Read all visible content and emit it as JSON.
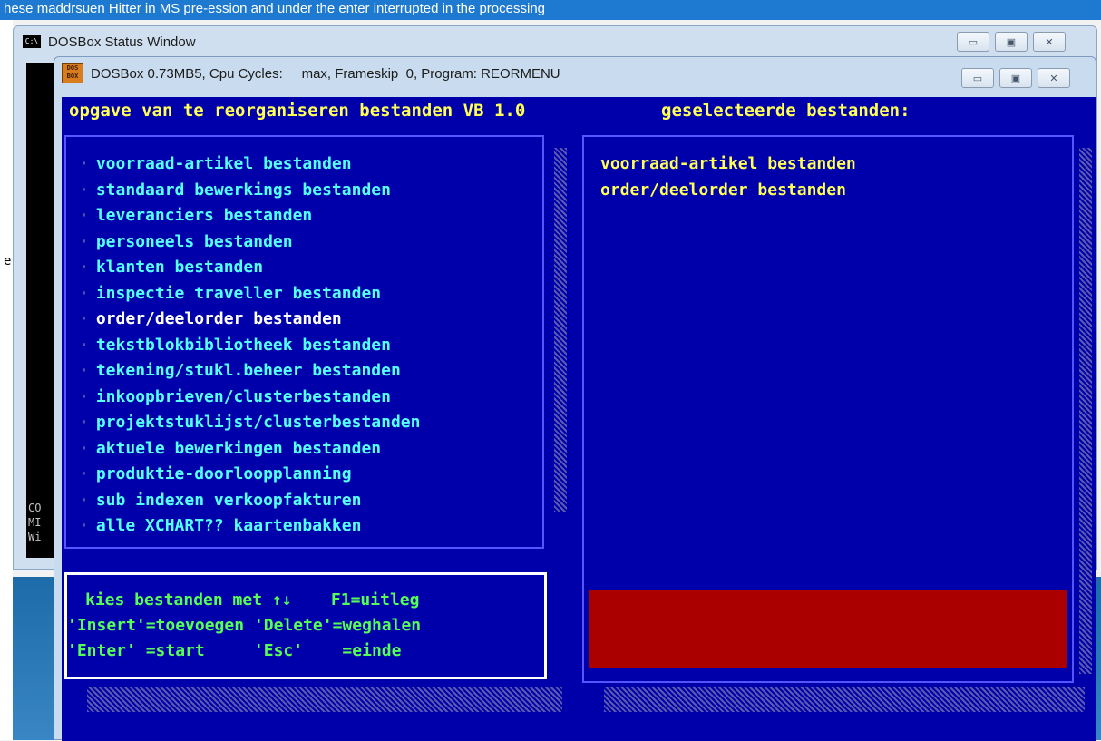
{
  "top_strip_text": "hese maddrsuen Hitter in MS pre-ession and under the enter interrupted in the processing",
  "status_window": {
    "title": "DOSBox Status Window",
    "console_lines": [
      "CO",
      "MI",
      "Wi"
    ]
  },
  "dos_window": {
    "title": "DOSBox 0.73MB5, Cpu Cycles:     max, Frameskip  0, Program: REORMENU"
  },
  "screen": {
    "header_left": "opgave van te reorganiseren bestanden VB 1.0",
    "header_right": "geselecteerde bestanden:",
    "menu_items": [
      "voorraad-artikel bestanden",
      "standaard bewerkings bestanden",
      "leveranciers bestanden",
      "personeels bestanden",
      "klanten bestanden",
      "inspectie traveller bestanden",
      "order/deelorder bestanden",
      "tekstblokbibliotheek bestanden",
      "tekening/stukl.beheer bestanden",
      "inkoopbrieven/clusterbestanden",
      "projektstuklijst/clusterbestanden",
      "aktuele bewerkingen bestanden",
      "produktie-doorloopplanning",
      "sub indexen verkoopfakturen",
      "alle XCHART?? kaartenbakken"
    ],
    "highlighted_index": 6,
    "selected_files": [
      "voorraad-artikel bestanden",
      "order/deelorder bestanden"
    ],
    "help_lines": [
      "kies bestanden met ↑↓    F1=uitleg",
      "'Insert'=toevoegen 'Delete'=weghalen",
      "'Enter' =start     'Esc'    =einde"
    ]
  },
  "desktop": {
    "left_glyph_e": "e",
    "left_glyph_h": "h"
  },
  "colors": {
    "dos_blue": "#0000aa",
    "yellow": "#ffff55",
    "cyan": "#55ffff",
    "green": "#55ff55",
    "red": "#aa0000"
  }
}
